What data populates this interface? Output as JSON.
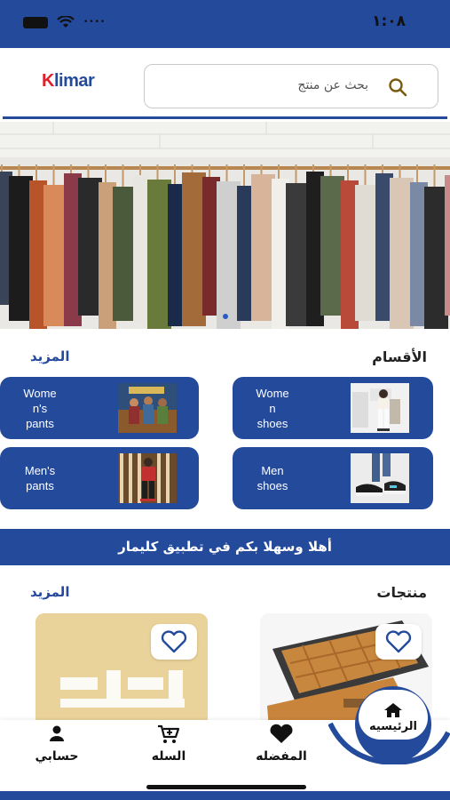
{
  "status_bar": {
    "time": "١:٠٨"
  },
  "header": {
    "logo_text_k": "K",
    "logo_text_rest": "limar",
    "search_placeholder": "بحث عن منتج"
  },
  "categories": {
    "title": "الأقسام",
    "more": "المزيد",
    "items": [
      {
        "label": "Wome\nn\nshoes",
        "image": "women-shoes-photo"
      },
      {
        "label": "Wome\nn's\npants",
        "image": "women-pants-photo"
      },
      {
        "label": "Men\nshoes",
        "image": "men-shoes-photo"
      },
      {
        "label": "Men's\npants",
        "image": "men-pants-photo"
      }
    ]
  },
  "welcome_banner": "أهلا وسهلا بكم في تطبيق  كليمار",
  "products": {
    "title": "منتجات",
    "more": "المزيد"
  },
  "tabbar": {
    "home": "الرئيسيه",
    "favorites": "المفضله",
    "cart": "السله",
    "account": "حسابي"
  },
  "colors": {
    "brand": "#244a9c",
    "accent": "#e0202a"
  }
}
